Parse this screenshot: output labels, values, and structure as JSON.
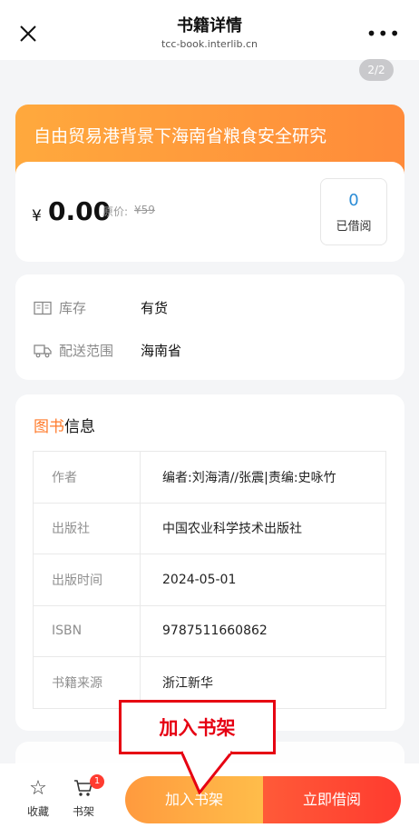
{
  "header": {
    "title": "书籍详情",
    "subtitle": "tcc-book.interlib.cn",
    "more_label": "•••"
  },
  "page_indicator": "2/2",
  "book": {
    "title": "自由贸易港背景下海南省粮食安全研究"
  },
  "price": {
    "currency": "¥",
    "value": "0.00",
    "original_label": "原价:",
    "original_value": "¥59"
  },
  "borrowed": {
    "count": "0",
    "label": "已借阅"
  },
  "stock": {
    "label": "库存",
    "value": "有货"
  },
  "delivery": {
    "label": "配送范围",
    "value": "海南省"
  },
  "info": {
    "heading_accent": "图书",
    "heading_rest": "信息",
    "rows": [
      {
        "key": "作者",
        "value": "编者:刘海清//张震|责编:史咏竹"
      },
      {
        "key": "出版社",
        "value": "中国农业科学技术出版社"
      },
      {
        "key": "出版时间",
        "value": "2024-05-01"
      },
      {
        "key": "ISBN",
        "value": "9787511660862"
      },
      {
        "key": "书籍来源",
        "value": "浙江新华"
      }
    ]
  },
  "bottom": {
    "favorite_label": "收藏",
    "shelf_label": "书架",
    "shelf_badge": "1",
    "add_to_shelf_label": "加入书架",
    "borrow_now_label": "立即借阅"
  },
  "callout": {
    "text": "加入书架",
    "color": "#e60012"
  },
  "colors": {
    "accent_orange": "#ff8b3a",
    "borrow_blue": "#2b8cd6",
    "borrow_red": "#ff3b2f"
  }
}
